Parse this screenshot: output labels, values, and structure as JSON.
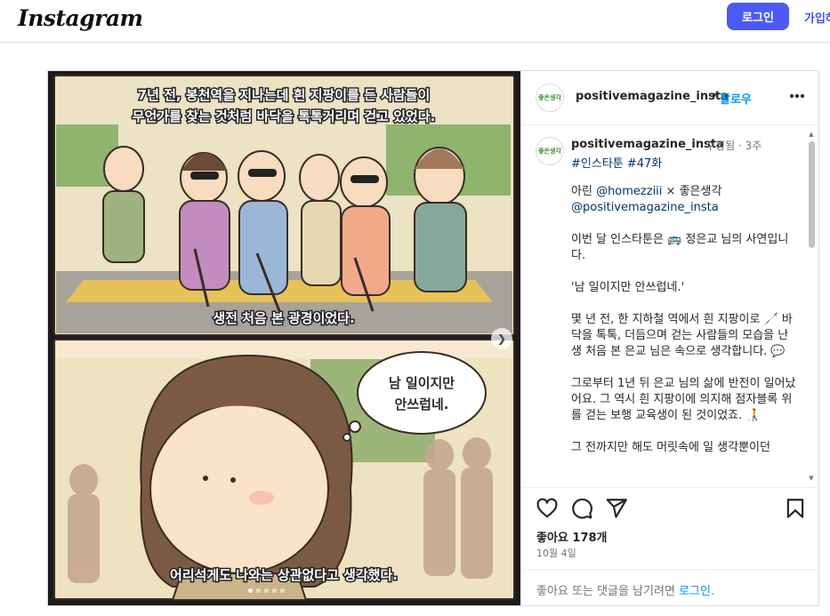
{
  "header": {
    "logo": "Instagram",
    "login_label": "로그인",
    "signup_label": "가입하"
  },
  "post": {
    "username": "positivemagazine_insta",
    "follow_sep": "•",
    "follow_label": "팔로우",
    "avatar_text": "좋은생각",
    "media": {
      "top_caption_line1": "7년 전, 봉천역을 지나는데 흰 지팡이를 든 사람들이",
      "top_caption_line2": "무언가를 찾는 것처럼 바닥을 톡톡거리며 걷고 있었다.",
      "top_bottom_caption": "생전 처음 본 광경이었다.",
      "speech_line1": "남 일이지만",
      "speech_line2": "안쓰럽네.",
      "bottom_caption": "어리석게도 나와는 상관없다고 생각했다.",
      "slide_count": 5,
      "active_slide": 0
    },
    "caption": {
      "username": "positivemagazine_insta",
      "edited": "수정됨 · 3주",
      "tags": "#인스타툰 #47화",
      "credit_prefix": "아린 ",
      "credit_handle1": "@homezziii",
      "credit_mid": " × 좋은생각",
      "credit_handle2": "@positivemagazine_insta",
      "p2": "이번 달 인스타툰은 🚌 정은교 님의 사연입니다.",
      "p3": "'남 일이지만 안쓰럽네.'",
      "p4": "몇 년 전, 한 지하철 역에서 흰 지팡이로 🦯 바닥을 톡톡, 더듬으며 걷는 사람들의 모습을 난생 처음 본 은교 님은 속으로 생각합니다. 💬",
      "p5": "그로부터 1년 뒤 은교 님의 삶에 반전이 일어났어요. 그 역시 흰 지팡이에 의지해 점자블록 위를 걷는 보행 교육생이 된 것이었죠. 🧑‍🦯",
      "p6": "그 전까지만 해도 머릿속에 일 생각뿐이던"
    },
    "likes": "좋아요 178개",
    "date": "10월 4일",
    "footer_prefix": "좋아요 또는 댓글을 남기려면 ",
    "footer_login": "로그인",
    "footer_suffix": "."
  },
  "colors": {
    "primary_button": "#4c5af5",
    "link_blue": "#0095f6",
    "hashtag": "#00376b"
  },
  "icons": [
    "heart-icon",
    "comment-icon",
    "share-icon",
    "bookmark-icon",
    "more-icon",
    "chevron-right-icon"
  ]
}
